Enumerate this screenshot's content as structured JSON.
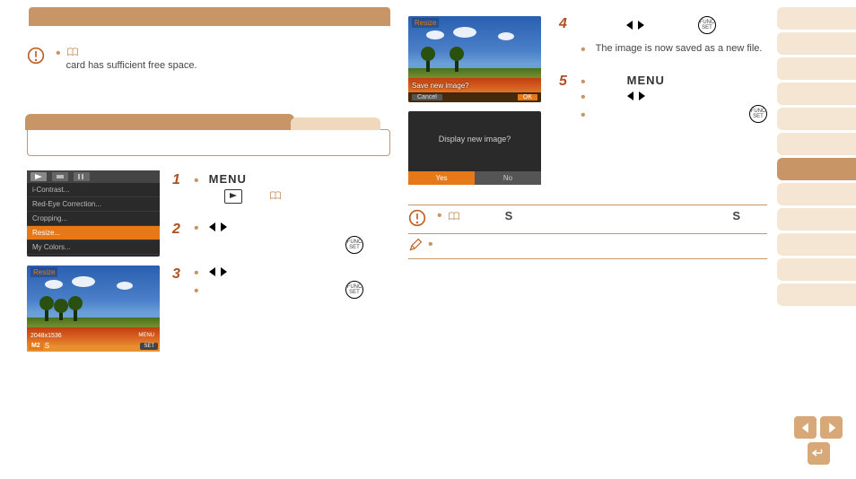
{
  "left": {
    "warn_text": "card has sufficient free space.",
    "menu_items": [
      "i-Contrast...",
      "Red-Eye Correction...",
      "Cropping...",
      "Resize...",
      "My Colors..."
    ],
    "resize_title": "Resize",
    "dimensions": "2048x1536",
    "menu_tag": "MENU",
    "set_tag": "SET",
    "size_badge": "M2",
    "size_s": "S",
    "steps": {
      "s1_num": "1",
      "s1_menu": "MENU",
      "s2_num": "2",
      "s3_num": "3",
      "func_label": "FUNC\nSET"
    }
  },
  "right": {
    "save_title": "Resize",
    "save_prompt": "Save new image?",
    "save_cancel": "Cancel",
    "save_ok": "OK",
    "display_prompt": "Display new image?",
    "display_yes": "Yes",
    "display_no": "No",
    "steps": {
      "s4_num": "4",
      "s4_text": "The image is now saved as a new file.",
      "s5_num": "5",
      "s5_menu": "MENU",
      "func_label": "FUNC\nSET"
    },
    "s_mark": "S"
  }
}
